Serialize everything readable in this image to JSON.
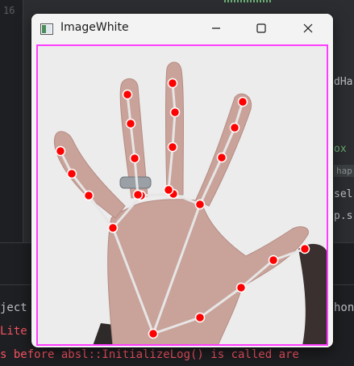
{
  "window": {
    "title": "ImageWhite",
    "controls": {
      "minimize": "minimize-icon",
      "maximize": "maximize-icon",
      "close": "close-icon"
    },
    "frame_color": "#ff3cff"
  },
  "image": {
    "landmark_color": "#ff0000",
    "connection_color": "#e6e6e6"
  },
  "ide": {
    "gutter_number": "16",
    "code_fragments": {
      "a": "dHa",
      "b": "ox",
      "c": "hap",
      "d": "sel",
      "e": "p.s"
    },
    "console_lines": [
      {
        "text": "ject",
        "style": "normal"
      },
      {
        "text": "Lite",
        "style": "red"
      },
      {
        "text": "s before absl::InitializeLog() is called are",
        "style": "red"
      }
    ],
    "console_right": "hon"
  }
}
